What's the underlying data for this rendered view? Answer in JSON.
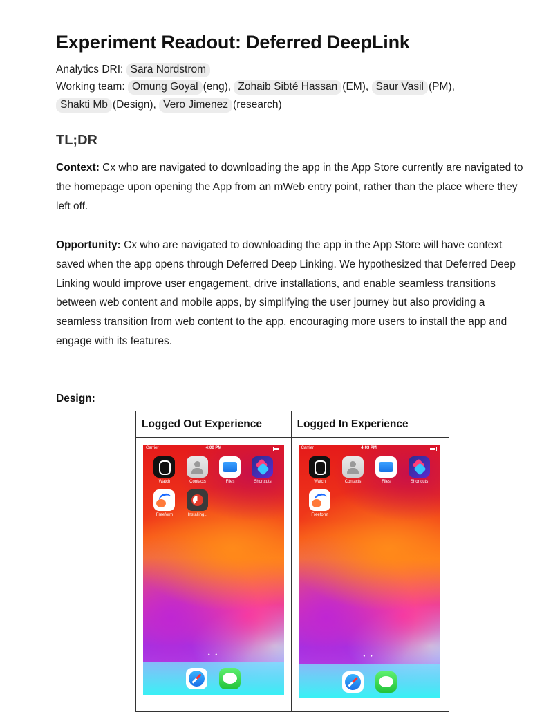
{
  "title": "Experiment Readout: Deferred DeepLink",
  "analytics": {
    "label": "Analytics DRI:",
    "dri": "Sara Nordstrom"
  },
  "team": {
    "label": "Working team:",
    "members": [
      {
        "name": "Omung Goyal",
        "role": "(eng),"
      },
      {
        "name": "Zohaib Sibté Hassan",
        "role": "(EM),"
      },
      {
        "name": "Saur Vasil",
        "role": "(PM),"
      },
      {
        "name": "Shakti Mb",
        "role": "(Design),"
      },
      {
        "name": "Vero Jimenez",
        "role": "(research)"
      }
    ]
  },
  "tldr": {
    "heading": "TL;DR",
    "context_label": "Context:",
    "context_text": "Cx who are navigated to downloading the app in the App Store currently are navigated to the homepage upon opening the App from an mWeb entry point, rather than the place where they left off.",
    "opportunity_label": "Opportunity:",
    "opportunity_text": "Cx who are navigated to downloading the app in the App Store will have context saved when the app opens through Deferred Deep Linking. We hypothesized that Deferred Deep Linking would improve user engagement, drive installations, and enable seamless transitions between web content and mobile apps, by simplifying the user journey but also providing a seamless transition from web content to the app, encouraging more users to install the app and engage with its features."
  },
  "design": {
    "label": "Design:",
    "columns": [
      "Logged Out Experience",
      "Logged In Experience"
    ],
    "screenshots": [
      {
        "carrier": "Carrier",
        "time": "4:00 PM",
        "apps": [
          "Watch",
          "Contacts",
          "Files",
          "Shortcuts",
          "Freeform",
          "Installing..."
        ],
        "dots": "● ●"
      },
      {
        "carrier": "Carrier",
        "time": "4:03 PM",
        "apps": [
          "Watch",
          "Contacts",
          "Files",
          "Shortcuts",
          "Freeform"
        ],
        "dots": "● ●"
      }
    ]
  }
}
